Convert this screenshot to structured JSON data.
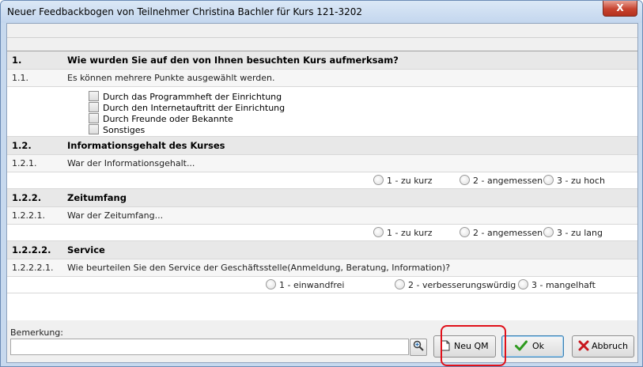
{
  "window": {
    "title": "Neuer Feedbackbogen von Teilnehmer Christina Bachler für Kurs 121-3202",
    "close_label": "X"
  },
  "sections": [
    {
      "type": "header",
      "num": "1.",
      "text": "Wie wurden Sie auf den von Ihnen besuchten Kurs aufmerksam?"
    },
    {
      "type": "sub",
      "num": "1.1.",
      "text": "Es können mehrere Punkte ausgewählt werden."
    },
    {
      "type": "checks",
      "items": [
        "Durch das Programmheft der Einrichtung",
        "Durch den Internetauftritt der Einrichtung",
        "Durch Freunde oder Bekannte",
        "Sonstiges"
      ]
    },
    {
      "type": "header",
      "num": "1.2.",
      "text": "Informationsgehalt des Kurses"
    },
    {
      "type": "sub",
      "num": "1.2.1.",
      "text": "War der Informationsgehalt..."
    },
    {
      "type": "options",
      "items": [
        "1 - zu kurz",
        "2 - angemessen",
        "3 - zu hoch"
      ]
    },
    {
      "type": "header",
      "num": "1.2.2.",
      "text": "Zeitumfang"
    },
    {
      "type": "sub",
      "num": "1.2.2.1.",
      "text": "War der Zeitumfang..."
    },
    {
      "type": "options",
      "items": [
        "1 - zu kurz",
        "2 - angemessen",
        "3 - zu lang"
      ]
    },
    {
      "type": "header",
      "num": "1.2.2.2.",
      "text": "Service"
    },
    {
      "type": "sub",
      "num": "1.2.2.2.1.",
      "text": "Wie beurteilen Sie den Service der Geschäftsstelle(Anmeldung, Beratung, Information)?"
    },
    {
      "type": "options",
      "items": [
        "1 - einwandfrei",
        "2 - verbesserungswürdig",
        "3 - mangelhaft"
      ]
    }
  ],
  "bottom": {
    "remark_label": "Bemerkung:",
    "remark_value": "",
    "new_qm_label": "Neu QM",
    "ok_label": "Ok",
    "cancel_label": "Abbruch"
  },
  "colors": {
    "highlight": "#e0101a",
    "ok_check": "#2e9a1f",
    "cancel_x": "#c8161d"
  },
  "icons": {
    "zoom": "magnifier-icon",
    "new": "new-document-icon",
    "ok": "checkmark-icon",
    "cancel": "x-mark-icon"
  }
}
